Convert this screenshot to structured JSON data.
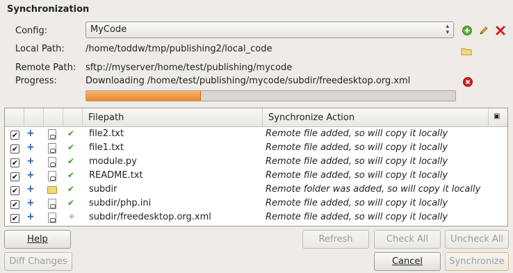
{
  "section_title": "Synchronization",
  "config": {
    "label": "Config:",
    "value": "MyCode"
  },
  "local_path": {
    "label": "Local Path:",
    "value": "/home/toddw/tmp/publishing2/local_code"
  },
  "remote_path": {
    "label": "Remote Path:",
    "value": "sftp://myserver/home/test/publishing/mycode"
  },
  "progress": {
    "label": "Progress:",
    "status": "Downloading /home/test/publishing/mycode/subdir/freedesktop.org.xml",
    "fraction": 0.31
  },
  "icons": {
    "add": "add-icon",
    "edit": "edit-pencil-icon",
    "delete": "delete-x-icon",
    "browse": "folder-icon",
    "cancel": "cancel-circle-icon"
  },
  "table": {
    "columns": [
      "Filepath",
      "Synchronize Action"
    ],
    "rows": [
      {
        "path": "file2.txt",
        "action": "Remote file added, so will copy it locally"
      },
      {
        "path": "file1.txt",
        "action": "Remote file added, so will copy it locally"
      },
      {
        "path": "module.py",
        "action": "Remote file added, so will copy it locally"
      },
      {
        "path": "README.txt",
        "action": "Remote file added, so will copy it locally"
      },
      {
        "path": "subdir",
        "action": "Remote folder was added, so will copy it locally"
      },
      {
        "path": "subdir/php.ini",
        "action": "Remote file added, so will copy it locally"
      },
      {
        "path": "subdir/freedesktop.org.xml",
        "action": "Remote file added, so will copy it locally"
      }
    ]
  },
  "buttons": {
    "help": "Help",
    "refresh": "Refresh",
    "check_all": "Check All",
    "uncheck_all": "Uncheck All",
    "diff_changes": "Diff Changes",
    "cancel": "Cancel",
    "synchronize": "Synchronize"
  },
  "colors": {
    "progress_fill": "#e9862b",
    "accent_plus": "#2a5db0",
    "ok_green": "#3c9a1e"
  }
}
